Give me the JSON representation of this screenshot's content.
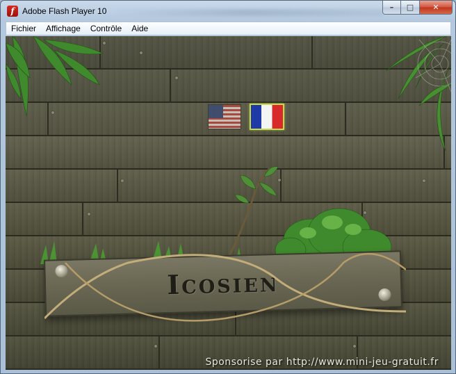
{
  "window": {
    "title": "Adobe Flash Player 10",
    "controls": {
      "minimize": "–",
      "maximize": "□",
      "close": "✕"
    },
    "app_icon": "flash-icon"
  },
  "menubar": {
    "items": [
      {
        "label": "Fichier"
      },
      {
        "label": "Affichage"
      },
      {
        "label": "Contrôle"
      },
      {
        "label": "Aide"
      }
    ]
  },
  "game": {
    "title": "Icosien",
    "languages": [
      {
        "name": "english-flag",
        "selected": false
      },
      {
        "name": "french-flag",
        "selected": true
      }
    ],
    "sponsor": "Sponsorise par http://www.mini-jeu-gratuit.fr"
  }
}
